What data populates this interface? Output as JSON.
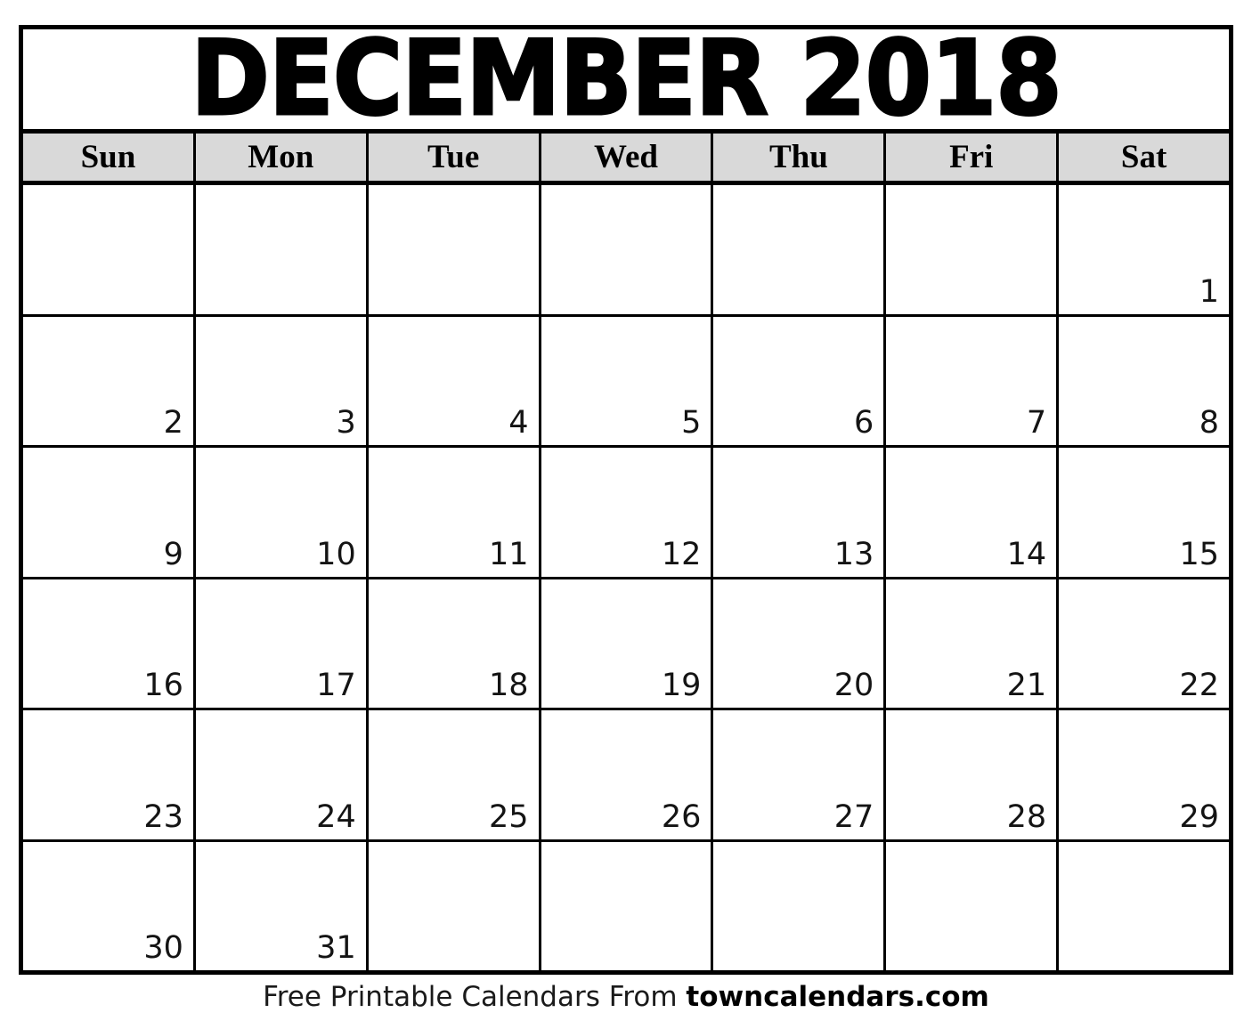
{
  "calendar": {
    "title": "DECEMBER 2018",
    "month": "DECEMBER",
    "year": "2018",
    "weekday_headers": [
      "Sun",
      "Mon",
      "Tue",
      "Wed",
      "Thu",
      "Fri",
      "Sat"
    ],
    "header_background_color": "#d9d9d9",
    "border_color": "#000000",
    "cell_background_color": "#ffffff",
    "weeks": [
      {
        "days": [
          "",
          "",
          "",
          "",
          "",
          "",
          "1"
        ]
      },
      {
        "days": [
          "2",
          "3",
          "4",
          "5",
          "6",
          "7",
          "8"
        ]
      },
      {
        "days": [
          "9",
          "10",
          "11",
          "12",
          "13",
          "14",
          "15"
        ]
      },
      {
        "days": [
          "16",
          "17",
          "18",
          "19",
          "20",
          "21",
          "22"
        ]
      },
      {
        "days": [
          "23",
          "24",
          "25",
          "26",
          "27",
          "28",
          "29"
        ]
      },
      {
        "days": [
          "30",
          "31",
          "",
          "",
          "",
          "",
          ""
        ]
      }
    ]
  },
  "footer": {
    "text": "Free Printable Calendars From ",
    "brand": "towncalendars.com"
  }
}
